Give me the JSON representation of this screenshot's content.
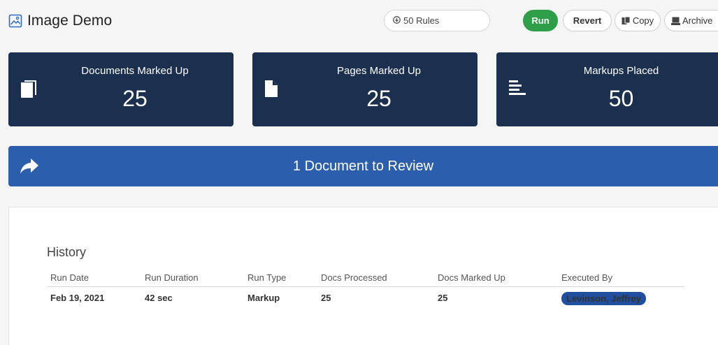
{
  "header": {
    "title": "Image Demo",
    "title_icon": "image-icon",
    "rules_label": "50 Rules",
    "buttons": {
      "run": "Run",
      "revert": "Revert",
      "copy": "Copy",
      "archive": "Archive"
    }
  },
  "stats": [
    {
      "label": "Documents Marked Up",
      "value": "25",
      "icon": "documents-icon"
    },
    {
      "label": "Pages Marked Up",
      "value": "25",
      "icon": "page-icon"
    },
    {
      "label": "Markups Placed",
      "value": "50",
      "icon": "markup-lines-icon"
    }
  ],
  "banner": {
    "text": "1 Document to Review",
    "icon": "share-arrow-icon"
  },
  "history": {
    "title": "History",
    "columns": [
      "Run Date",
      "Run Duration",
      "Run Type",
      "Docs Processed",
      "Docs Marked Up",
      "Executed By"
    ],
    "rows": [
      {
        "run_date": "Feb 19, 2021",
        "duration": "42 sec",
        "type": "Markup",
        "processed": "25",
        "marked_up": "25",
        "executed_by": "Levinson, Jeffrey"
      }
    ]
  },
  "colors": {
    "card_bg": "#1b2f4f",
    "banner_bg": "#2b5fad",
    "run_green": "#2e9e48",
    "badge_blue": "#1f4f9e"
  }
}
